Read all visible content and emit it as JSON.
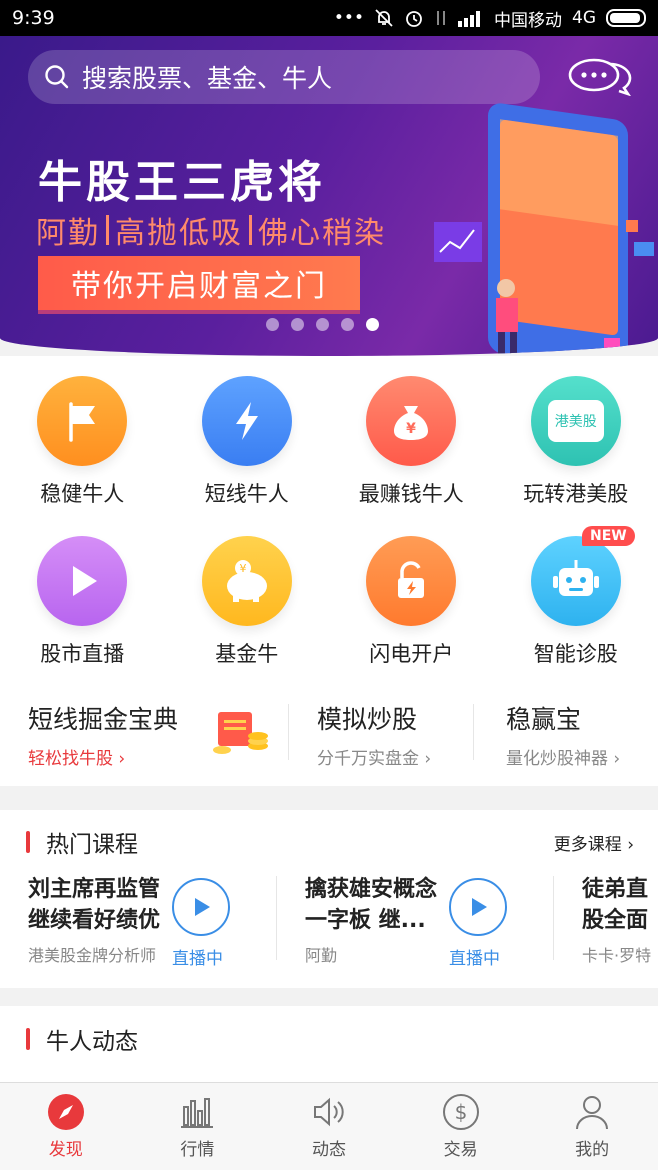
{
  "status_bar": {
    "time": "9:39",
    "carrier": "中国移动",
    "network": "4G"
  },
  "banner": {
    "search_placeholder": "搜索股票、基金、牛人",
    "title": "牛股王三虎将",
    "subtitle_parts": [
      "阿勤",
      "高抛低吸",
      "佛心稍染"
    ],
    "cta": "带你开启财富之门",
    "carousel_active_index": 4,
    "carousel_count": 5
  },
  "features": [
    {
      "label": "稳健牛人",
      "icon": "flag-icon",
      "color": "#ffa21f"
    },
    {
      "label": "短线牛人",
      "icon": "lightning-icon",
      "color": "#4a8df2"
    },
    {
      "label": "最赚钱牛人",
      "icon": "money-bag-icon",
      "color": "#ff6b5a"
    },
    {
      "label": "玩转港美股",
      "icon": "hk-us-stock-icon",
      "color": "#3fd0c0",
      "icon_text": "港美股"
    },
    {
      "label": "股市直播",
      "icon": "play-icon",
      "color": "#c77df0"
    },
    {
      "label": "基金牛",
      "icon": "piggy-bank-icon",
      "color": "#ffc21f"
    },
    {
      "label": "闪电开户",
      "icon": "unlock-icon",
      "color": "#ff8a3d"
    },
    {
      "label": "智能诊股",
      "icon": "robot-icon",
      "color": "#3fbdf0",
      "badge": "NEW"
    }
  ],
  "promos": [
    {
      "title": "短线掘金宝典",
      "subtitle": "轻松找牛股",
      "highlight": true
    },
    {
      "title": "模拟炒股",
      "subtitle": "分千万实盘金",
      "highlight": false
    },
    {
      "title": "稳赢宝",
      "subtitle": "量化炒股神器",
      "highlight": false
    }
  ],
  "hot_courses": {
    "title": "热门课程",
    "more": "更多课程",
    "items": [
      {
        "title_line1": "刘主席再监管",
        "title_line2": "继续看好绩优",
        "author": "港美股金牌分析师",
        "status": "直播中"
      },
      {
        "title_line1": "擒获雄安概念",
        "title_line2": "一字板 继...",
        "author": "阿勤",
        "status": "直播中"
      },
      {
        "title_line1": "徒弟直",
        "title_line2": "股全面",
        "author": "卡卡·罗特"
      }
    ]
  },
  "dynamics": {
    "title": "牛人动态"
  },
  "tabs": [
    {
      "label": "发现",
      "icon": "compass-icon",
      "active": true
    },
    {
      "label": "行情",
      "icon": "chart-bars-icon",
      "active": false
    },
    {
      "label": "动态",
      "icon": "speaker-icon",
      "active": false
    },
    {
      "label": "交易",
      "icon": "dollar-icon",
      "active": false
    },
    {
      "label": "我的",
      "icon": "user-icon",
      "active": false
    }
  ],
  "colors": {
    "accent_red": "#e8393c",
    "live_blue": "#3a8ee6",
    "banner_purple": "#5a1f9e"
  }
}
